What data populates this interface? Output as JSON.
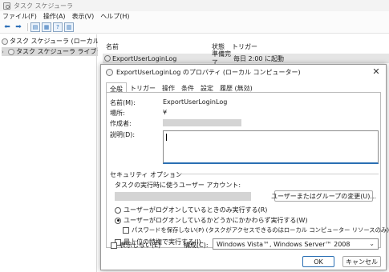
{
  "window": {
    "title": "タスク スケジューラ"
  },
  "menu": [
    "ファイル(F)",
    "操作(A)",
    "表示(V)",
    "ヘルプ(H)"
  ],
  "tree": {
    "root": "タスク スケジューラ (ローカル)",
    "library": "タスク スケジューラ ライブラリ"
  },
  "list": {
    "columns": [
      "名前",
      "状態",
      "トリガー"
    ],
    "row": {
      "name": "ExportUserLoginLog",
      "status": "準備完了",
      "trigger": "毎日 2:00 に起動"
    }
  },
  "dialog": {
    "title": "ExportUserLoginLog のプロパティ (ローカル コンピューター)",
    "close": "✕",
    "tabs": [
      "全般",
      "トリガー",
      "操作",
      "条件",
      "設定",
      "履歴 (無効)"
    ],
    "name_label": "名前(M):",
    "name_value": "ExportUserLoginLog",
    "location_label": "場所:",
    "location_value": "¥",
    "author_label": "作成者:",
    "description_label": "説明(D):",
    "security_title": "セキュリティ オプション",
    "run_account_label": "タスクの実行時に使うユーザー アカウント:",
    "change_user_button": "ユーザーまたはグループの変更(U)...",
    "radio_logged_on": "ユーザーがログオンしているときのみ実行する(R)",
    "radio_whether_logged": "ユーザーがログオンしているかどうかにかかわらず実行する(W)",
    "no_store_password": "パスワードを保存しない(P) (タスクがアクセスできるのはローカル コンピューター リソースのみ)",
    "highest_privileges": "最上位の特権で実行する(I)",
    "hidden_label": "表示しない(E)",
    "configure_label": "構成(C):",
    "configure_value": "Windows Vista™, Windows Server™ 2008",
    "ok_button": "OK",
    "cancel_button": "キャンセル"
  },
  "colors": {
    "accent": "#2a6fb3",
    "selection": "#d9d9d9"
  }
}
